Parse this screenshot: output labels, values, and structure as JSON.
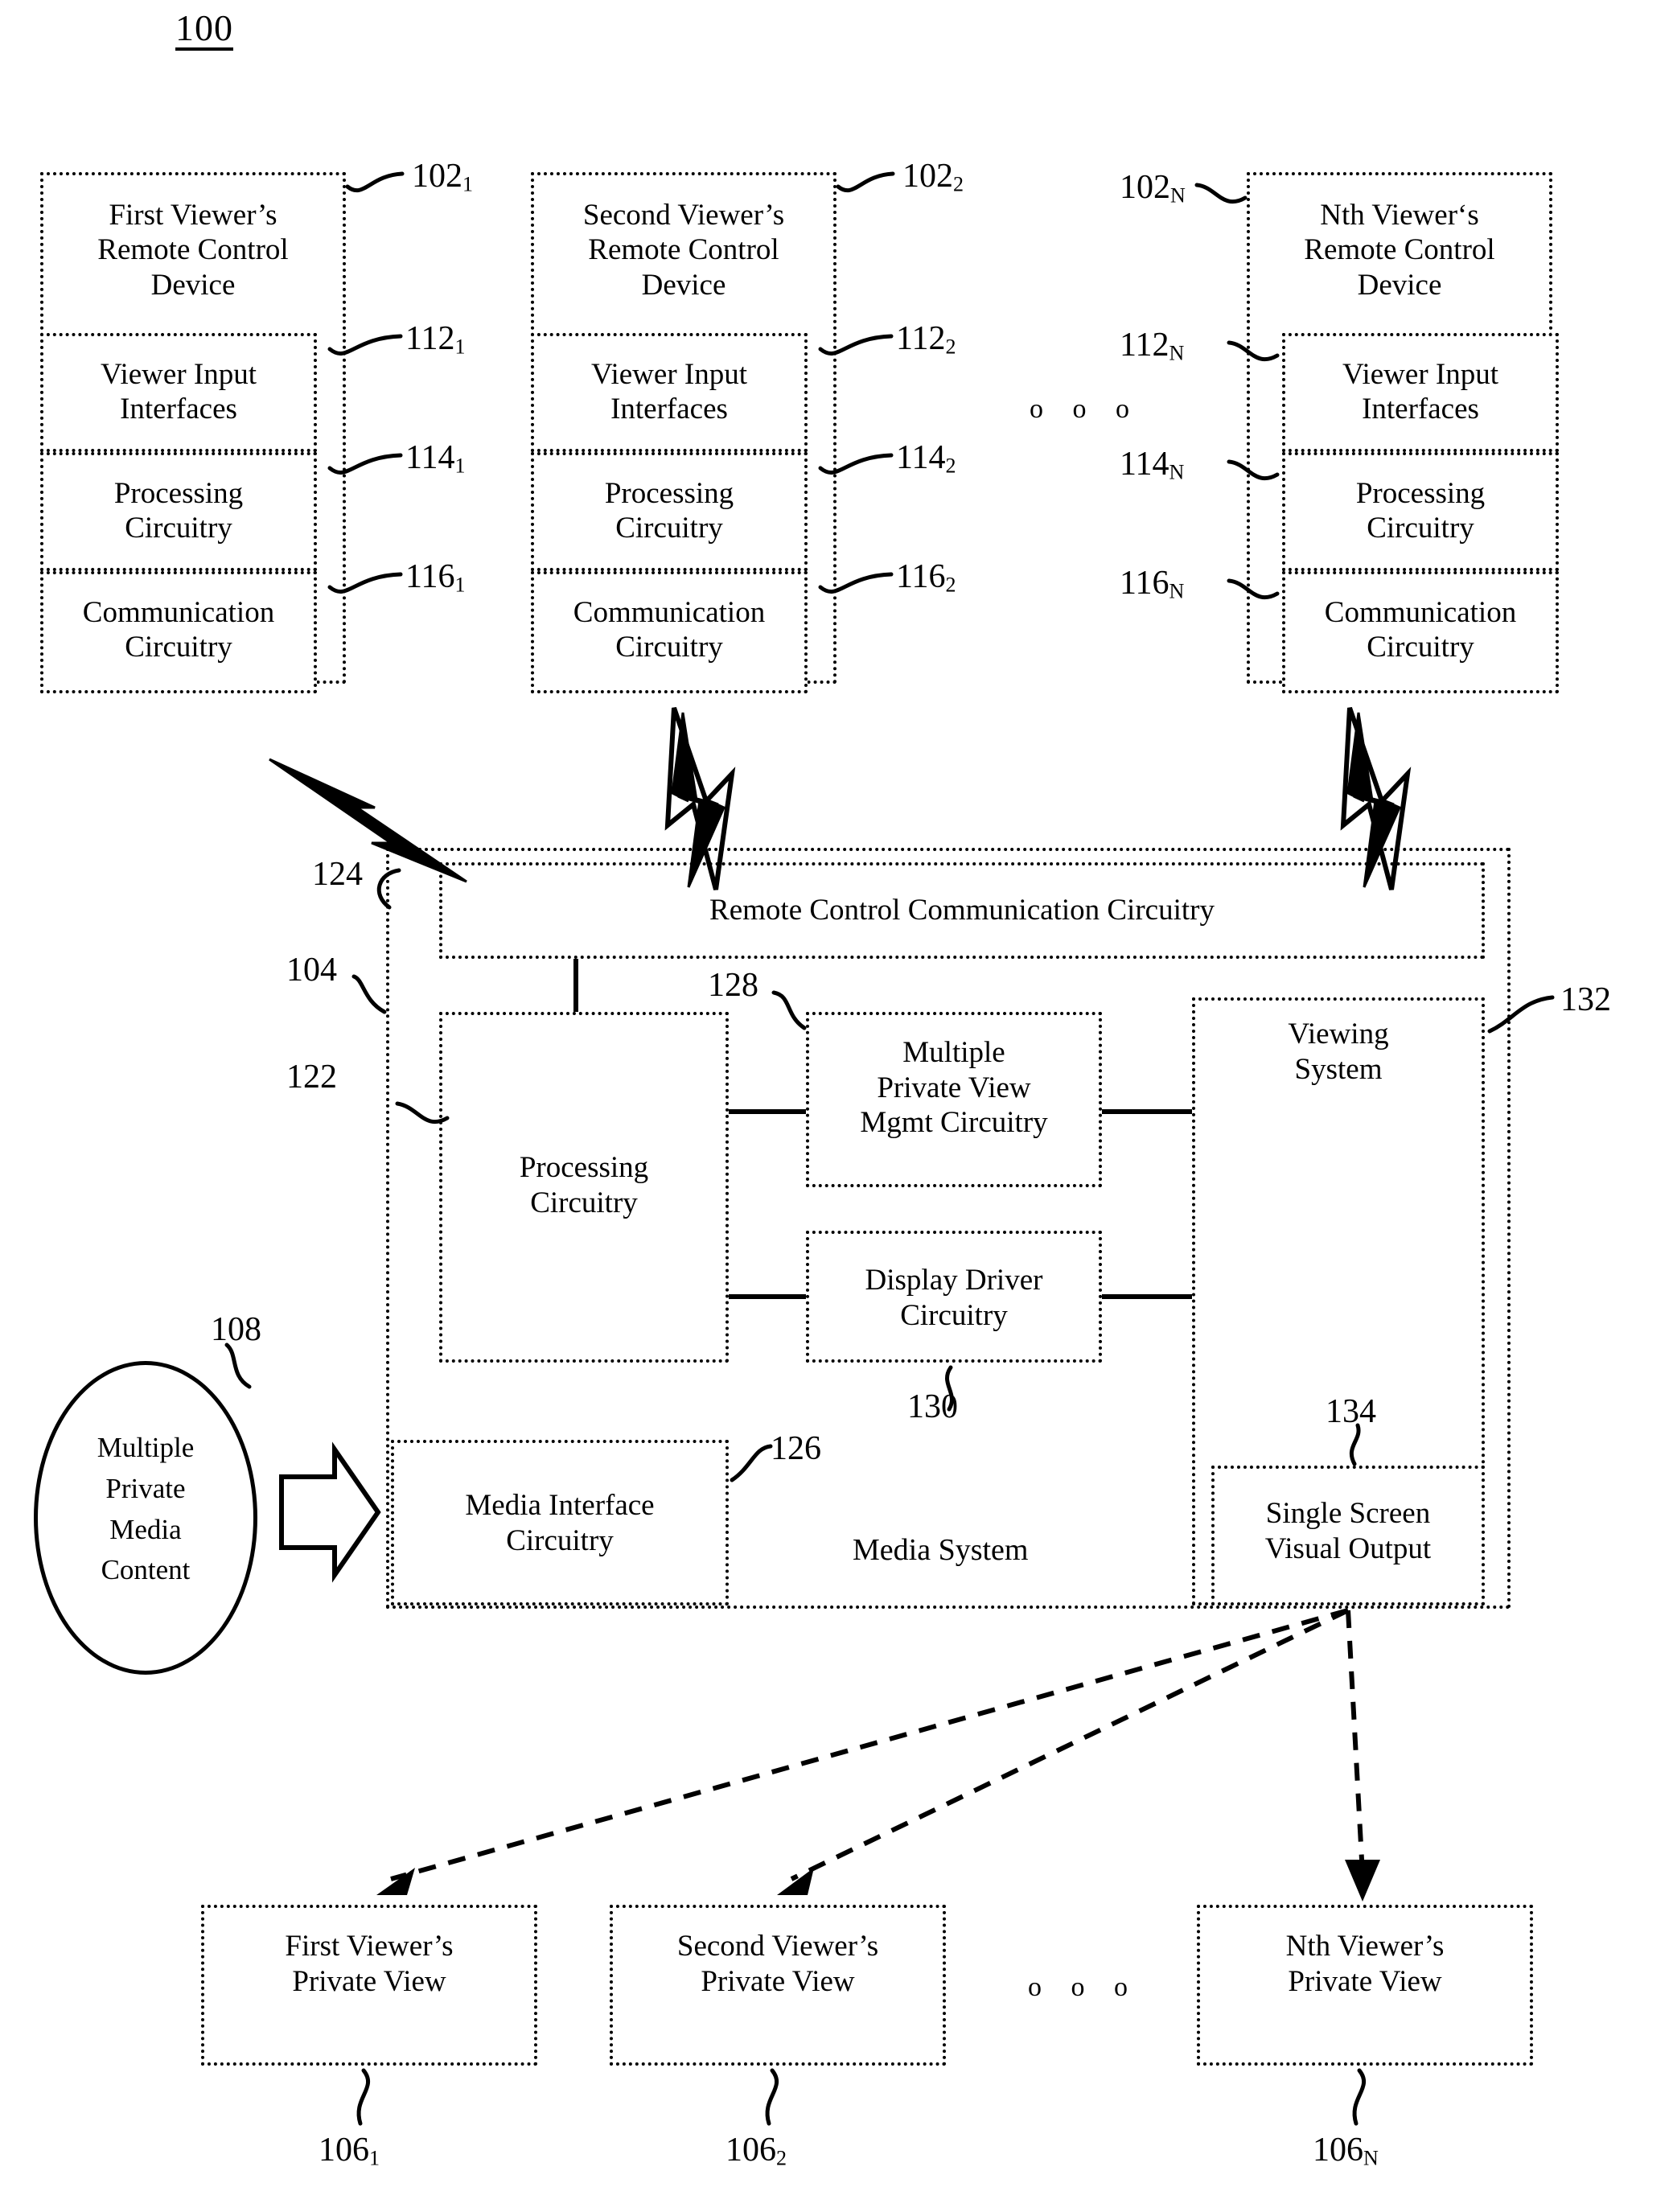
{
  "figure": {
    "number": "100"
  },
  "ellipsis": {
    "glyph": "o o o"
  },
  "remote_devices": [
    {
      "title": "First Viewer’s\nRemote Control\nDevice",
      "ref": "102",
      "sub": "1",
      "modules": [
        {
          "label": "Viewer Input\nInterfaces",
          "ref": "112",
          "sub": "1"
        },
        {
          "label": "Processing\nCircuitry",
          "ref": "114",
          "sub": "1"
        },
        {
          "label": "Communication\nCircuitry",
          "ref": "116",
          "sub": "1"
        }
      ]
    },
    {
      "title": "Second Viewer’s\nRemote Control\nDevice",
      "ref": "102",
      "sub": "2",
      "modules": [
        {
          "label": "Viewer Input\nInterfaces",
          "ref": "112",
          "sub": "2"
        },
        {
          "label": "Processing\nCircuitry",
          "ref": "114",
          "sub": "2"
        },
        {
          "label": "Communication\nCircuitry",
          "ref": "116",
          "sub": "2"
        }
      ]
    },
    {
      "title": "Nth Viewer‘s\nRemote Control\nDevice",
      "ref": "102",
      "sub": "N",
      "modules": [
        {
          "label": "Viewer Input\nInterfaces",
          "ref": "112",
          "sub": "N"
        },
        {
          "label": "Processing\nCircuitry",
          "ref": "114",
          "sub": "N"
        },
        {
          "label": "Communication\nCircuitry",
          "ref": "116",
          "sub": "N"
        }
      ]
    }
  ],
  "media_system": {
    "ref": "104",
    "label": "Media System",
    "rc_comm": {
      "label": "Remote Control Communication Circuitry",
      "ref": "124"
    },
    "processing": {
      "label": "Processing\nCircuitry",
      "ref": "122"
    },
    "mpv_mgmt": {
      "label": "Multiple\nPrivate View\nMgmt Circuitry",
      "ref": "128"
    },
    "display_driver": {
      "label": "Display Driver\nCircuitry",
      "ref": "130"
    },
    "media_interface": {
      "label": "Media Interface\nCircuitry",
      "ref": "126"
    },
    "viewing_system": {
      "label": "Viewing\nSystem",
      "ref": "132"
    },
    "single_screen": {
      "label": "Single Screen\nVisual Output",
      "ref": "134"
    }
  },
  "media_content": {
    "label": "Multiple\nPrivate\nMedia\nContent",
    "ref": "108"
  },
  "private_views": [
    {
      "label": "First Viewer’s\nPrivate View",
      "ref": "106",
      "sub": "1"
    },
    {
      "label": "Second Viewer’s\nPrivate View",
      "ref": "106",
      "sub": "2"
    },
    {
      "label": "Nth Viewer’s\nPrivate View",
      "ref": "106",
      "sub": "N"
    }
  ],
  "colors": {
    "ink": "#000000",
    "paper": "#ffffff"
  }
}
